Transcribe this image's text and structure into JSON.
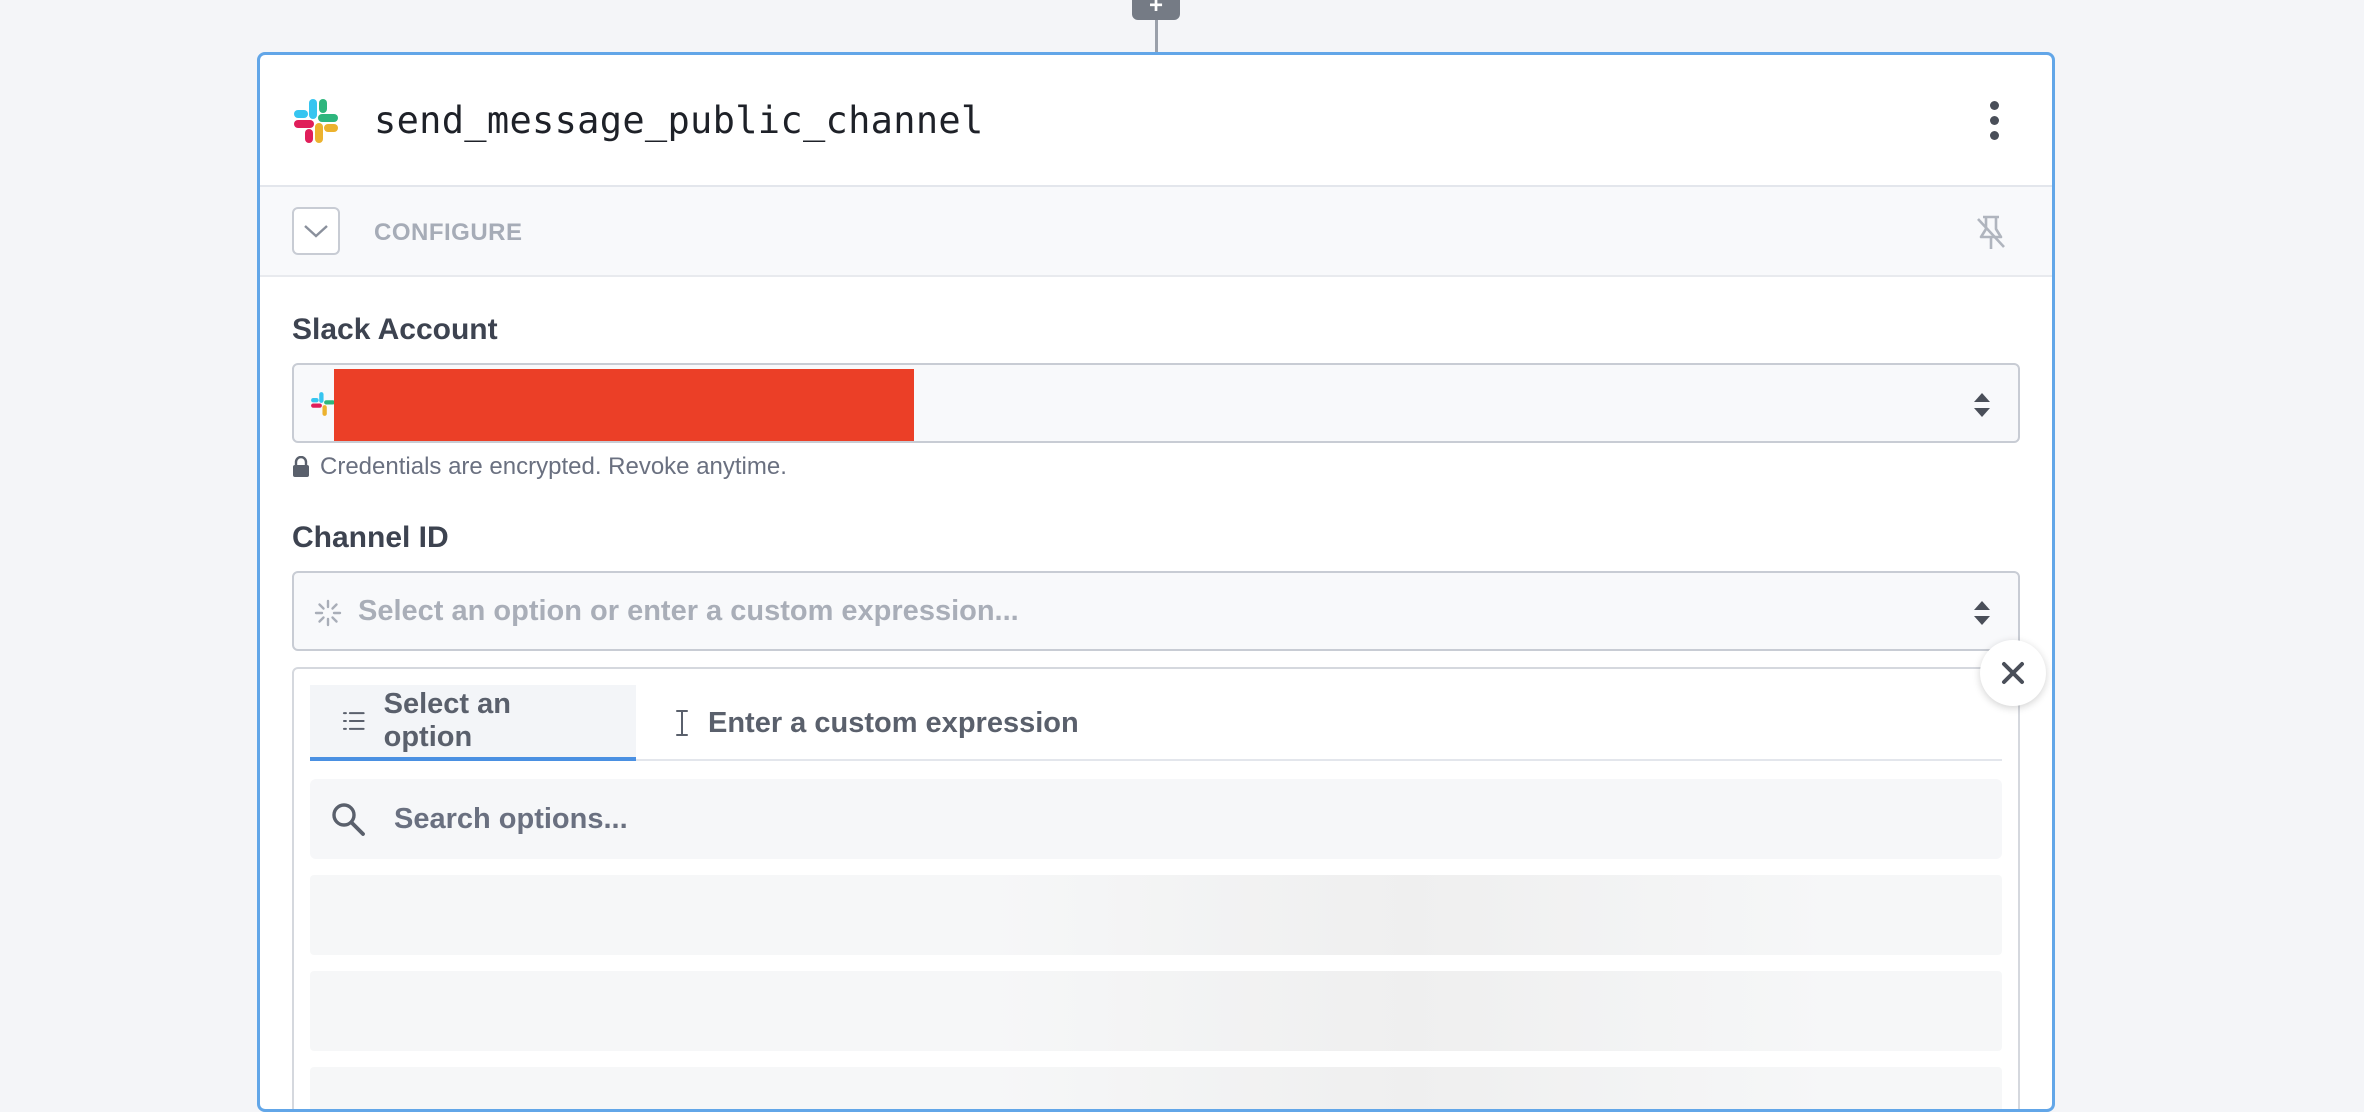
{
  "step": {
    "name": "send_message_public_channel",
    "app_icon": "slack-icon",
    "menu_icon": "more-vertical-icon"
  },
  "config_bar": {
    "label": "CONFIGURE",
    "toggle_icon": "chevron-down-icon",
    "pin_icon": "pin-off-icon"
  },
  "fields": {
    "slack_account": {
      "label": "Slack Account",
      "hint": "Credentials are encrypted. Revoke anytime.",
      "hint_icon": "lock-icon"
    },
    "channel_id": {
      "label": "Channel ID",
      "placeholder": "Select an option or enter a custom expression..."
    }
  },
  "dropdown": {
    "tabs": [
      {
        "label": "Select an option",
        "icon": "list-icon",
        "active": true
      },
      {
        "label": "Enter a custom expression",
        "icon": "text-cursor-icon",
        "active": false
      }
    ],
    "search": {
      "placeholder": "Search options..."
    }
  },
  "colors": {
    "accent": "#4a90e2",
    "card_border": "#62a6e8",
    "redaction": "#eb3f27"
  }
}
